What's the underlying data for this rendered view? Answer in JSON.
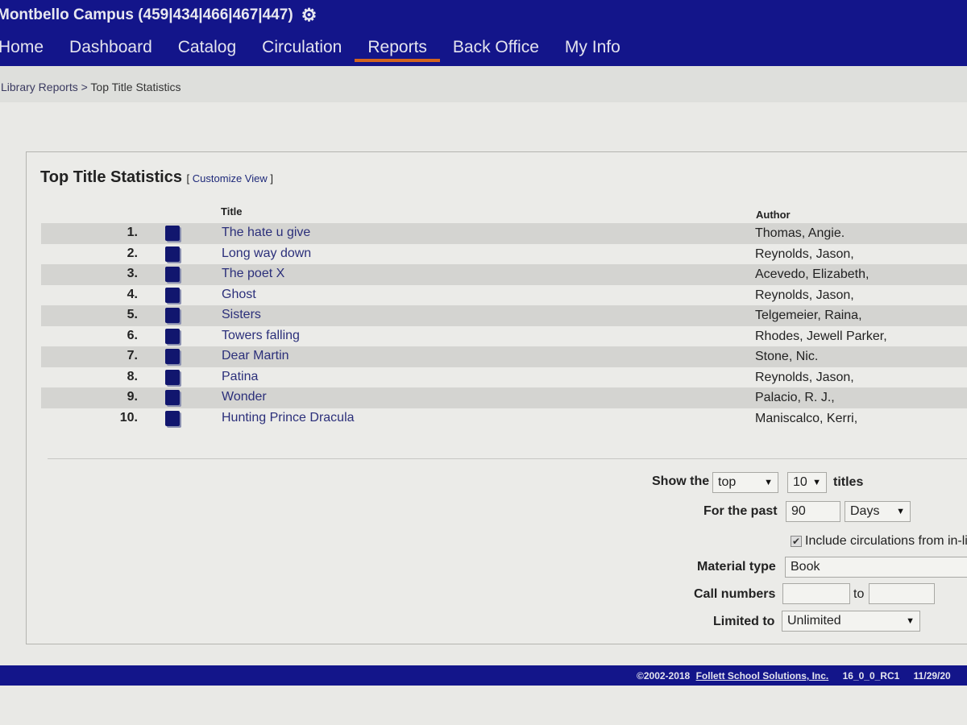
{
  "header": {
    "campus": "Montbello Campus (459|434|466|467|447)",
    "settings_icon": "gear-icon"
  },
  "nav": [
    {
      "label": "Home",
      "active": false
    },
    {
      "label": "Dashboard",
      "active": false
    },
    {
      "label": "Catalog",
      "active": false
    },
    {
      "label": "Circulation",
      "active": false
    },
    {
      "label": "Reports",
      "active": true
    },
    {
      "label": "Back Office",
      "active": false
    },
    {
      "label": "My Info",
      "active": false
    }
  ],
  "breadcrumb": {
    "parent": "Library Reports",
    "separator": ">",
    "current": "Top Title Statistics"
  },
  "panel": {
    "title": "Top Title Statistics",
    "customize_open": "[",
    "customize_link": "Customize View",
    "customize_close": "]",
    "columns": {
      "title": "Title",
      "author": "Author"
    },
    "rows": [
      {
        "rank": "1.",
        "icon": "book-icon",
        "title": "The hate u give",
        "author": "Thomas, Angie."
      },
      {
        "rank": "2.",
        "icon": "book-icon",
        "title": "Long way down",
        "author": "Reynolds, Jason,"
      },
      {
        "rank": "3.",
        "icon": "book-icon",
        "title": "The poet X",
        "author": "Acevedo, Elizabeth,"
      },
      {
        "rank": "4.",
        "icon": "book-icon",
        "title": "Ghost",
        "author": "Reynolds, Jason,"
      },
      {
        "rank": "5.",
        "icon": "book-icon",
        "title": "Sisters",
        "author": "Telgemeier, Raina,"
      },
      {
        "rank": "6.",
        "icon": "book-icon",
        "title": "Towers falling",
        "author": "Rhodes, Jewell Parker,"
      },
      {
        "rank": "7.",
        "icon": "book-icon",
        "title": "Dear Martin",
        "author": "Stone, Nic."
      },
      {
        "rank": "8.",
        "icon": "book-icon",
        "title": "Patina",
        "author": "Reynolds, Jason,"
      },
      {
        "rank": "9.",
        "icon": "book-icon",
        "title": "Wonder",
        "author": "Palacio, R. J.,"
      },
      {
        "rank": "10.",
        "icon": "book-icon",
        "title": "Hunting Prince Dracula",
        "author": "Maniscalco, Kerri,"
      }
    ]
  },
  "form": {
    "show_the_label": "Show the",
    "show_the_value": "top",
    "count_value": "10",
    "titles_label": "titles",
    "for_past_label": "For the past",
    "for_past_value": "90",
    "period_value": "Days",
    "include_checked": true,
    "include_label": "Include circulations from in-lib",
    "material_type_label": "Material type",
    "material_type_value": "Book",
    "call_numbers_label": "Call numbers",
    "call_from_value": "",
    "to_label": "to",
    "call_to_value": "",
    "limited_to_label": "Limited to",
    "limited_to_value": "Unlimited"
  },
  "footer": {
    "copyright": "©2002-2018",
    "company_link": "Follett School Solutions, Inc.",
    "version": "16_0_0_RC1",
    "date": "11/29/20"
  },
  "colors": {
    "header_bg": "#13158a",
    "active_tab_underline": "#d2641e",
    "link": "#2b2f7a"
  }
}
